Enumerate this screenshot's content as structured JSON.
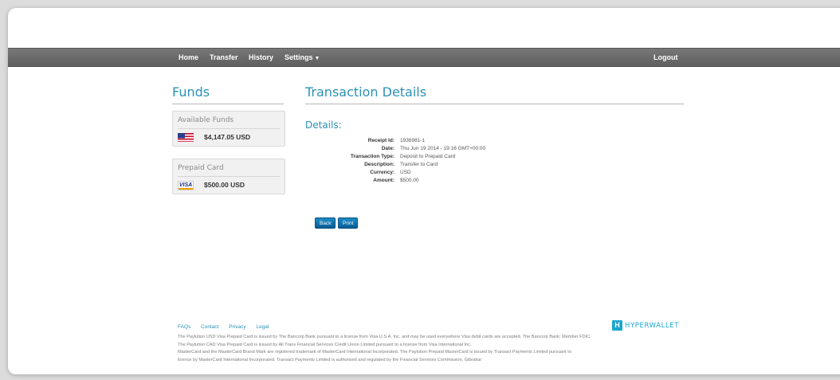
{
  "nav": {
    "home": "Home",
    "transfer": "Transfer",
    "history": "History",
    "settings": "Settings",
    "logout": "Logout"
  },
  "sidebar": {
    "title": "Funds",
    "available": {
      "title": "Available Funds",
      "amount": "$4,147.05 USD",
      "icon": "us-flag-icon"
    },
    "prepaid": {
      "title": "Prepaid Card",
      "amount": "$500.00 USD",
      "icon": "visa-card-icon",
      "brand": "VISA"
    }
  },
  "main": {
    "title": "Transaction Details",
    "section": "Details:",
    "rows": [
      {
        "label": "Receipt Id:",
        "value": "1936981-1"
      },
      {
        "label": "Date:",
        "value": "Thu Jun 19 2014 - 19:16 GMT+00:00"
      },
      {
        "label": "Transaction Type:",
        "value": "Deposit to Prepaid Card"
      },
      {
        "label": "Description:",
        "value": "Transfer to Card"
      },
      {
        "label": "Currency:",
        "value": "USD"
      },
      {
        "label": "Amount:",
        "value": "$500.00"
      }
    ],
    "back_label": "Back",
    "print_label": "Print"
  },
  "footer": {
    "links": [
      "FAQs",
      "Contact",
      "Privacy",
      "Legal"
    ],
    "brand": "HYPERWALLET",
    "brand_mark": "H",
    "lines": [
      "The Paylution USD Visa Prepaid Card is issued by The Bancorp Bank pursuant to a license from Visa U.S.A. Inc. and may be used everywhere Visa debit cards are accepted. The Bancorp Bank; Member FDIC.",
      "The Paylution CAD Visa Prepaid Card is issued by All Trans Financial Services Credit Union Limited pursuant to a license from Visa International Inc.",
      "MasterCard and the MasterCard Brand Mark are registered trademark of MasterCard International Incorporated. The Paylution Prepaid MasterCard is issued by Transact Payments Limited pursuant to",
      "licence by MasterCard International Incorporated. Transact Payments Limited is authorised and regulated by the Financial Services Commission, Gibraltar"
    ]
  },
  "colors": {
    "accent": "#2b91b6",
    "navbar": "#6b6b6b",
    "button": "#0a6aa8",
    "brand": "#1aa6cf"
  }
}
